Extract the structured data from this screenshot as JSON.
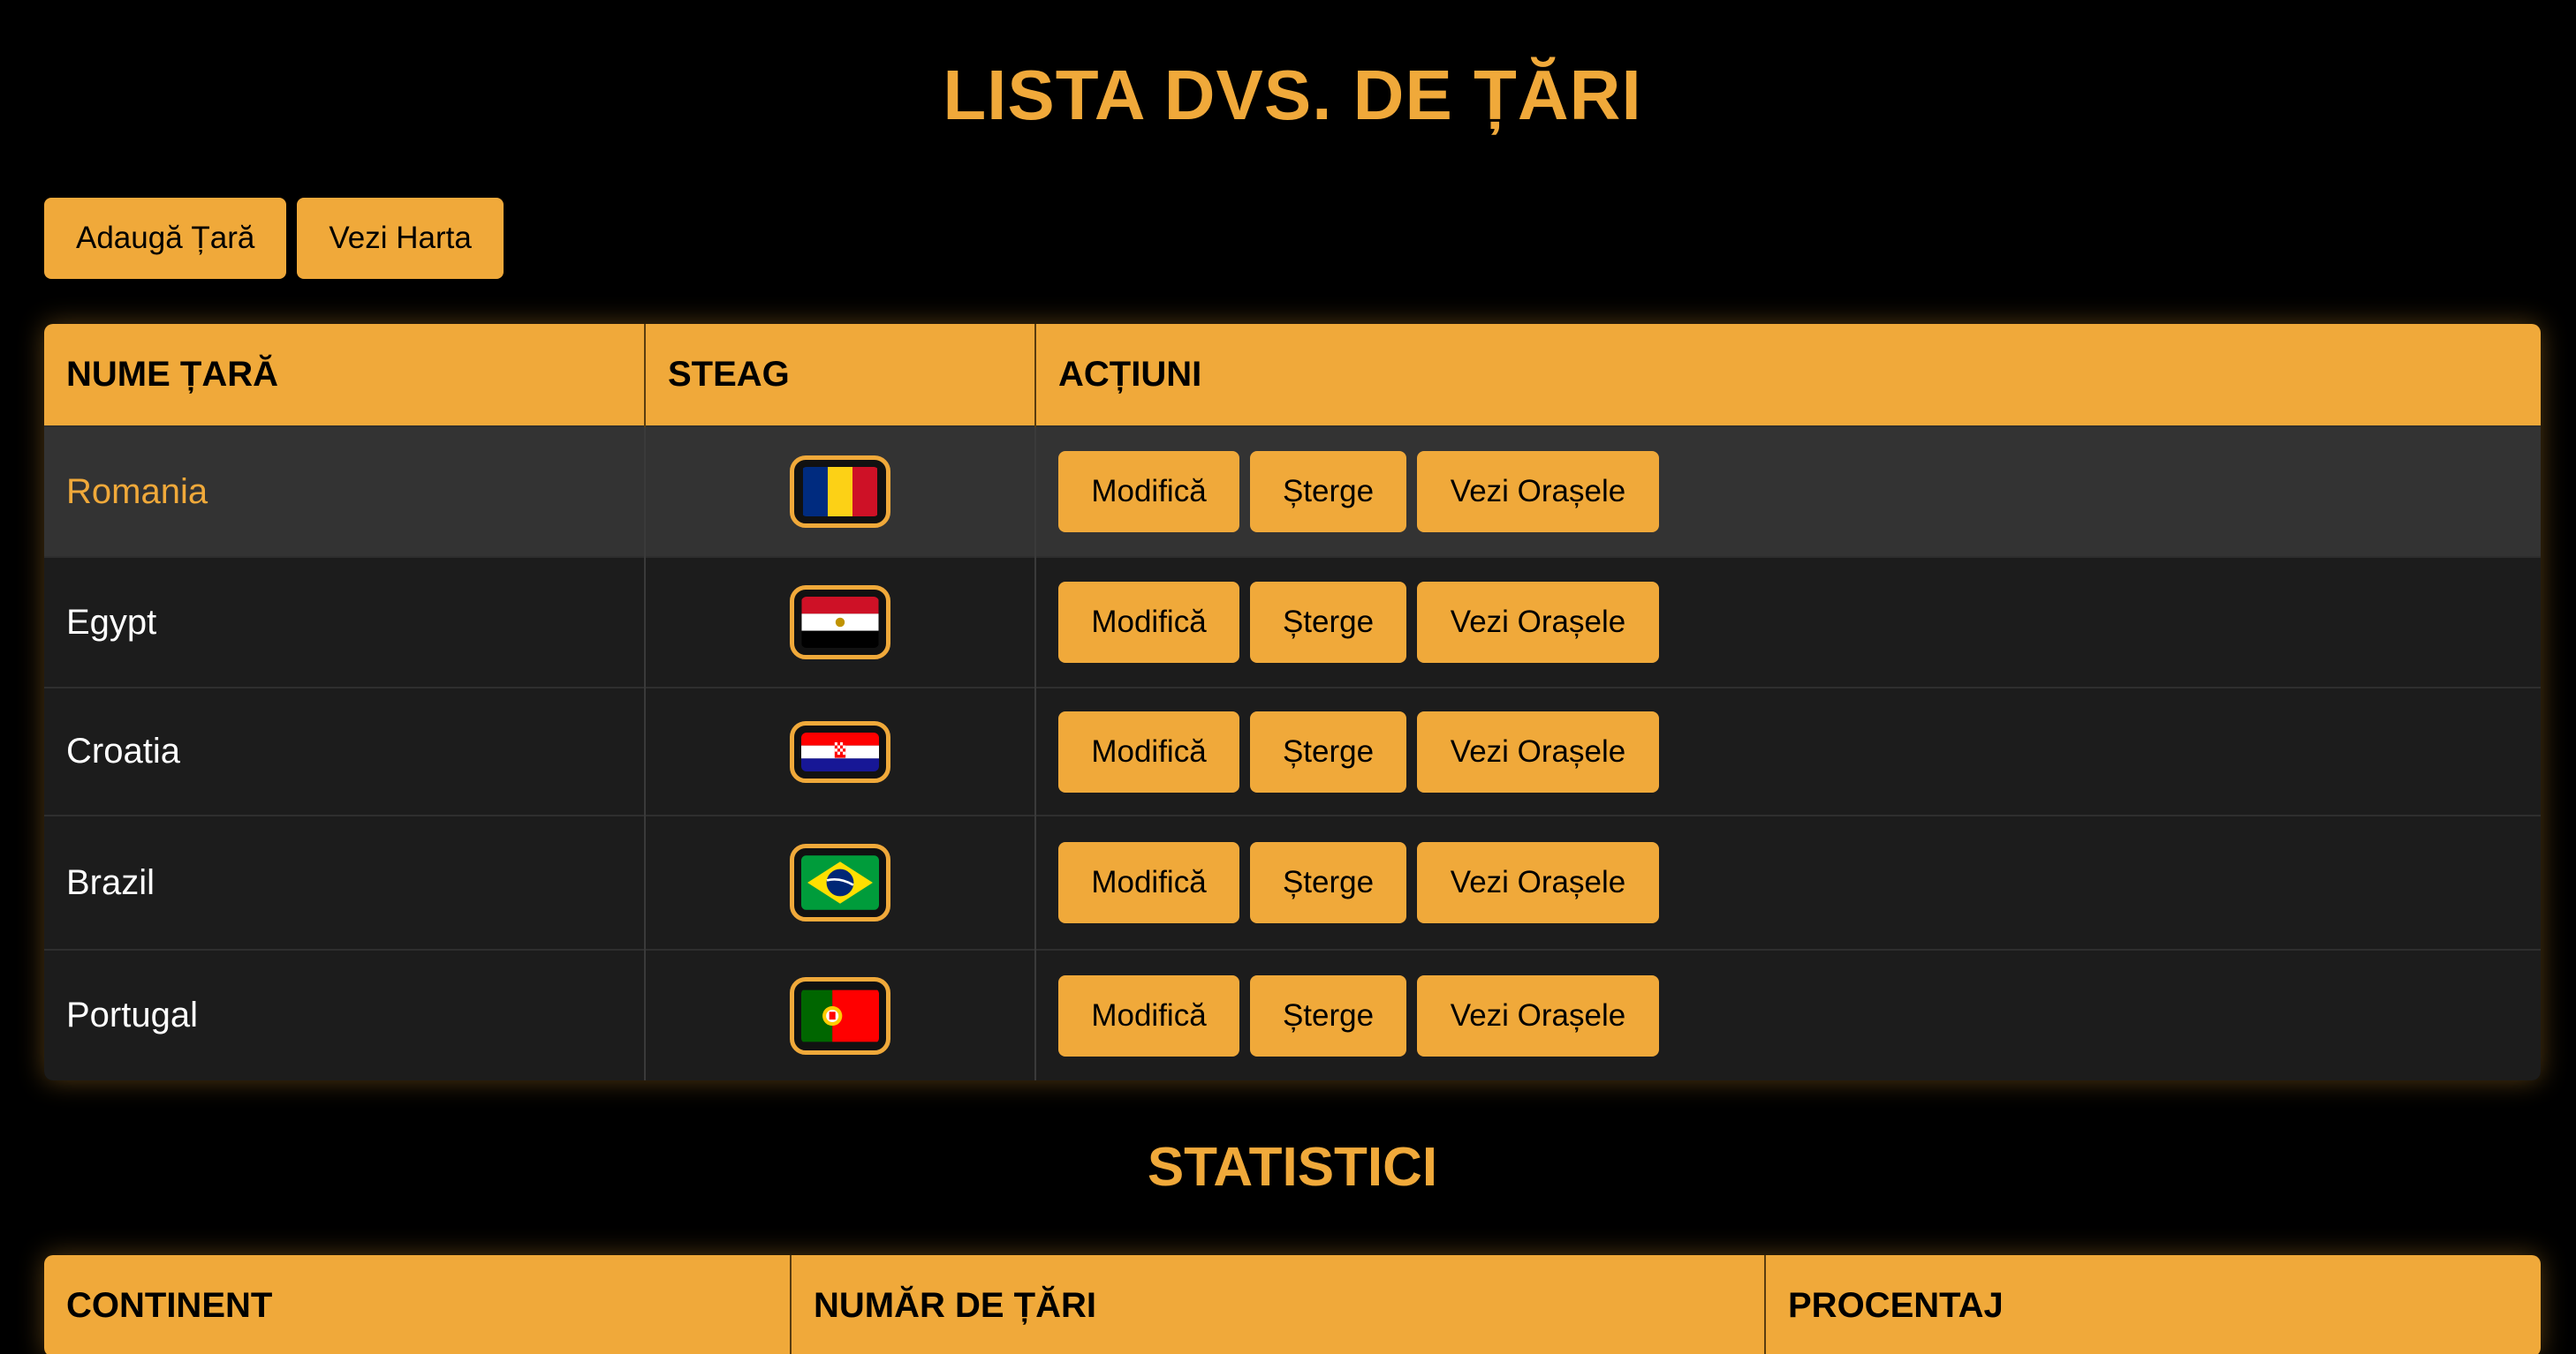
{
  "header": {
    "title": "LISTA DVS. DE ȚĂRI"
  },
  "toolbar": {
    "add_label": "Adaugă Țară",
    "map_label": "Vezi Harta"
  },
  "countries_table": {
    "headers": [
      "NUME ȚARĂ",
      "STEAG",
      "ACȚIUNI"
    ],
    "rows": [
      {
        "name": "Romania",
        "flag": "romania-flag"
      },
      {
        "name": "Egypt",
        "flag": "egypt-flag"
      },
      {
        "name": "Croatia",
        "flag": "croatia-flag"
      },
      {
        "name": "Brazil",
        "flag": "brazil-flag"
      },
      {
        "name": "Portugal",
        "flag": "portugal-flag"
      }
    ],
    "actions": {
      "edit": "Modifică",
      "delete": "Șterge",
      "cities": "Vezi Orașele"
    }
  },
  "stats": {
    "title": "STATISTICI",
    "headers": [
      "CONTINENT",
      "NUMĂR DE ȚĂRI",
      "PROCENTAJ"
    ]
  },
  "colors": {
    "accent": "#F0A93A",
    "background": "#000000",
    "row": "#1c1c1c",
    "row_active": "#333333"
  }
}
